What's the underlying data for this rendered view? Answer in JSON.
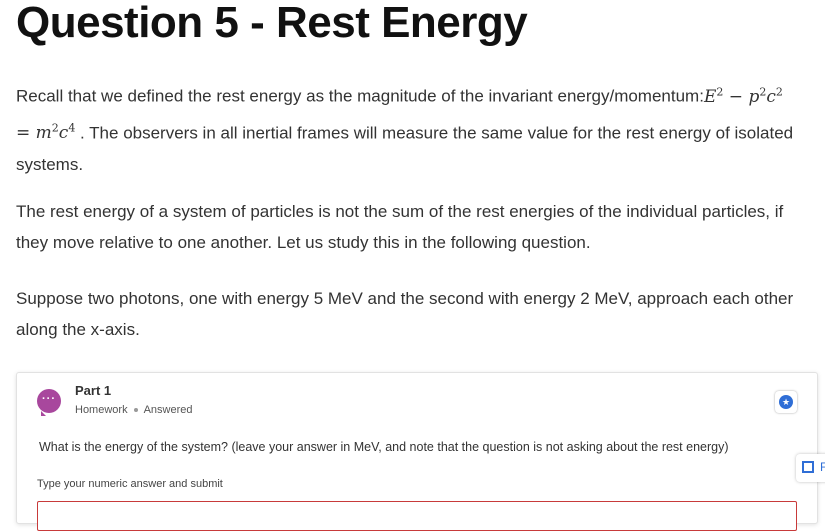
{
  "page": {
    "title": "Question 5  - Rest Energy"
  },
  "intro": {
    "text_before": "Recall that we defined the rest energy as the magnitude of the invariant energy/momentum:",
    "eq_E": "E",
    "eq_E_exp": "2",
    "eq_minus": " −",
    "eq_p": "p",
    "eq_p_exp": "2",
    "eq_c1": "c",
    "eq_c1_exp": "2",
    "eq_equals": " = ",
    "eq_m": "m",
    "eq_m_exp": "2",
    "eq_c2": "c",
    "eq_c2_exp": "4",
    "text_after": " . The observers in all inertial frames will measure the same value for the rest energy of isolated systems."
  },
  "para2": "The rest energy of a system of particles is not the sum of the rest energies of the individual particles, if they move relative to one another. Let us study this in the following question.",
  "para3": "Suppose two photons, one with energy 5 MeV and the second with energy 2 MeV, approach each other along the x-axis.",
  "part": {
    "title": "Part 1",
    "type": "Homework",
    "status": "Answered",
    "question": "What is the energy of the system? (leave your answer in MeV, and note that the question is not asking about the rest energy)",
    "answer_label": "Type your numeric answer and submit",
    "answer_value": ""
  },
  "side_tab": {
    "letter": "F"
  },
  "colors": {
    "accent": "#2f6ed6",
    "chat_icon": "#a8479d",
    "input_error_border": "#c83a3a"
  }
}
